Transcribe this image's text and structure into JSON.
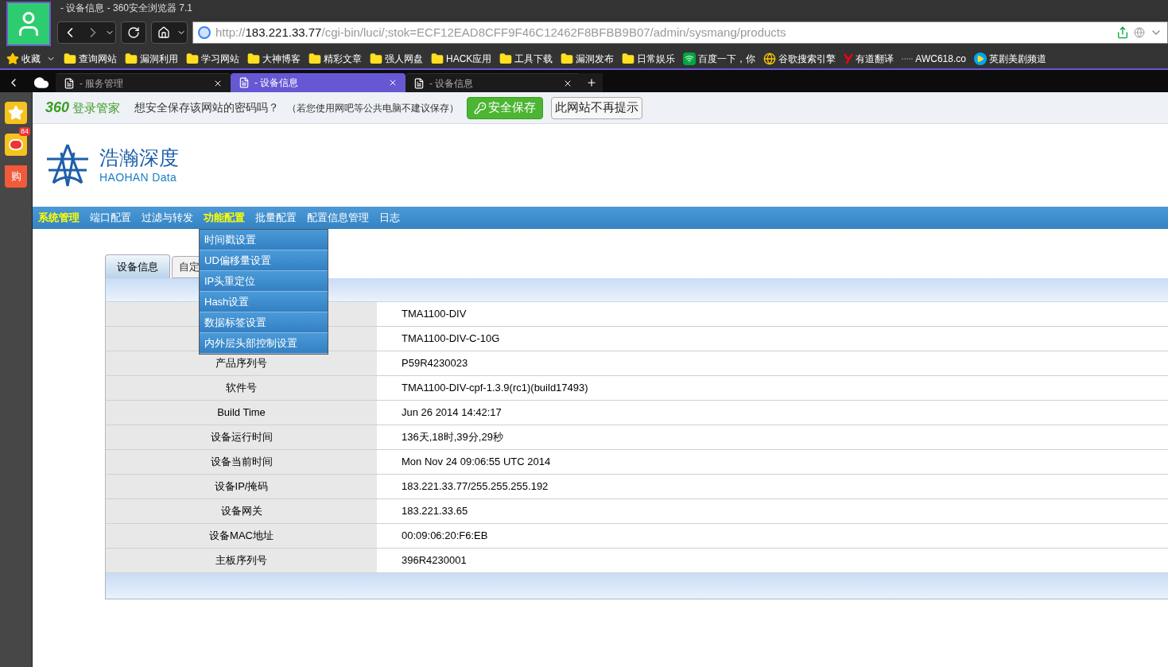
{
  "window": {
    "title": "- 设备信息 - 360安全浏览器 7.1"
  },
  "address_bar": {
    "scheme": "http://",
    "host": "183.221.33.77",
    "path": "/cgi-bin/luci/;stok=ECF12EAD8CFF9F46C12462F8BFBB9B07/admin/sysmang/products"
  },
  "bookmarks": [
    {
      "kind": "favorites",
      "label": "收藏"
    },
    {
      "kind": "folder",
      "label": "查询网站"
    },
    {
      "kind": "folder",
      "label": "漏洞利用"
    },
    {
      "kind": "folder",
      "label": "学习网站"
    },
    {
      "kind": "folder",
      "label": "大神博客"
    },
    {
      "kind": "folder",
      "label": "精彩文章"
    },
    {
      "kind": "folder",
      "label": "强人网盘"
    },
    {
      "kind": "folder",
      "label": "HACK应用"
    },
    {
      "kind": "folder",
      "label": "工具下载"
    },
    {
      "kind": "folder",
      "label": "漏洞发布"
    },
    {
      "kind": "folder",
      "label": "日常娱乐"
    },
    {
      "kind": "wifi",
      "label": "百度一下，你"
    },
    {
      "kind": "google",
      "label": "谷歌搜索引擎"
    },
    {
      "kind": "youdao",
      "label": "有道翻译"
    },
    {
      "kind": "dash",
      "label": "AWC618.co"
    },
    {
      "kind": "play",
      "label": "英剧美剧频道"
    }
  ],
  "tabs": [
    {
      "label": "- 服务管理",
      "selected": false
    },
    {
      "label": "- 设备信息",
      "selected": true
    },
    {
      "label": "- 设备信息",
      "selected": false
    }
  ],
  "sidebar": {
    "weibo_badge": "84",
    "shop_glyph": "购"
  },
  "password_bar": {
    "brand_number": "360",
    "brand": "登录管家",
    "question": "想安全保存该网站的密码吗？",
    "note": "（若您使用网吧等公共电脑不建议保存）",
    "save_button": "安全保存",
    "dismiss_button": "此网站不再提示"
  },
  "logo": {
    "name": "浩瀚深度",
    "subtitle": "HAOHAN Data"
  },
  "nav": [
    {
      "label": "系统管理",
      "highlighted": true
    },
    {
      "label": "端口配置",
      "highlighted": false
    },
    {
      "label": "过滤与转发",
      "highlighted": false
    },
    {
      "label": "功能配置",
      "highlighted": true
    },
    {
      "label": "批量配置",
      "highlighted": false
    },
    {
      "label": "配置信息管理",
      "highlighted": false
    },
    {
      "label": "日志",
      "highlighted": false
    }
  ],
  "dropdown": [
    "时间戳设置",
    "UD偏移量设置",
    "IP头重定位",
    "Hash设置",
    "数据标签设置",
    "内外层头部控制设置"
  ],
  "page_tabs": [
    {
      "label": "设备信息",
      "selected": true
    },
    {
      "label": "自定",
      "selected": false
    }
  ],
  "table": [
    {
      "value": "TMA1100-DIV"
    },
    {
      "value": "TMA1100-DIV-C-10G"
    },
    {
      "label": "产品序列号",
      "value": "P59R4230023"
    },
    {
      "label": "软件号",
      "value": "TMA1100-DIV-cpf-1.3.9(rc1)(build17493)"
    },
    {
      "label": "Build Time",
      "value": "Jun 26 2014 14:42:17"
    },
    {
      "label": "设备运行时间",
      "value": "136天,18时,39分,29秒"
    },
    {
      "label": "设备当前时间",
      "value": "Mon Nov 24 09:06:55 UTC 2014"
    },
    {
      "label": "设备IP/掩码",
      "value": "183.221.33.77/255.255.255.192"
    },
    {
      "label": "设备网关",
      "value": "183.221.33.65"
    },
    {
      "label": "设备MAC地址",
      "value": "00:09:06:20:F6:EB"
    },
    {
      "label": "主板序列号",
      "value": "396R4230001"
    }
  ]
}
